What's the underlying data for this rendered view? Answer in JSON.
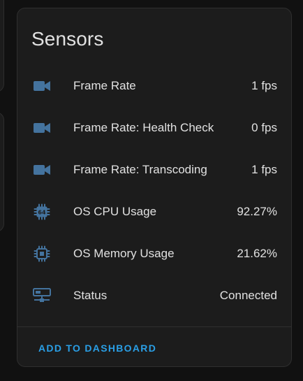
{
  "card": {
    "title": "Sensors",
    "action_label": "ADD TO DASHBOARD"
  },
  "colors": {
    "icon": "#44739e",
    "accent": "#2a9fe6",
    "card_bg": "#1c1c1c",
    "page_bg": "#111111"
  },
  "sensors": [
    {
      "icon": "video-camera-icon",
      "label": "Frame Rate",
      "value": "1 fps"
    },
    {
      "icon": "video-camera-icon",
      "label": "Frame Rate: Health Check",
      "value": "0 fps"
    },
    {
      "icon": "video-camera-icon",
      "label": "Frame Rate: Transcoding",
      "value": "1 fps"
    },
    {
      "icon": "cpu-64-bit-icon",
      "label": "OS CPU Usage",
      "value": "92.27%"
    },
    {
      "icon": "memory-chip-icon",
      "label": "OS Memory Usage",
      "value": "21.62%"
    },
    {
      "icon": "network-status-icon",
      "label": "Status",
      "value": "Connected"
    }
  ]
}
